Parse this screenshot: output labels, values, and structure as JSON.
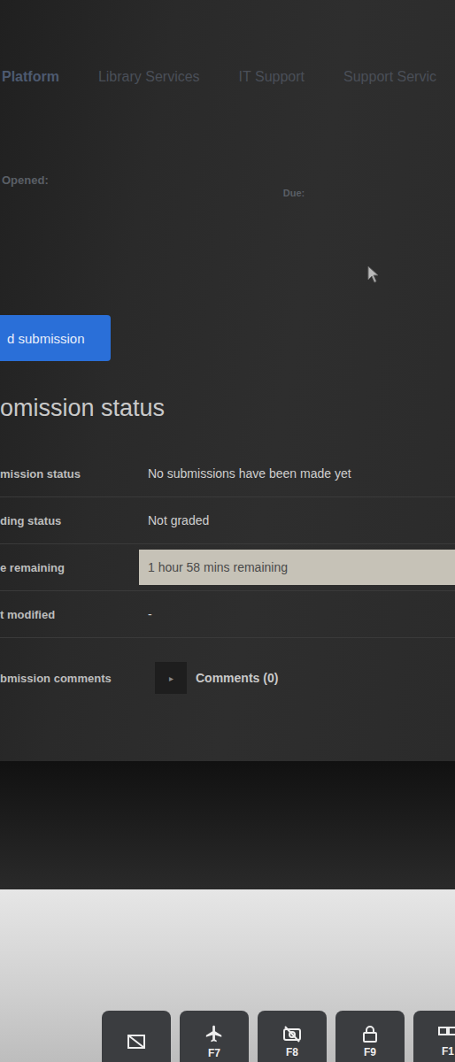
{
  "nav": [
    {
      "label": "Platform"
    },
    {
      "label": "Library Services"
    },
    {
      "label": "IT Support"
    },
    {
      "label": "Support Servic"
    }
  ],
  "dates": {
    "opened_label": "Opened:",
    "due_label": "Due:"
  },
  "submit_button": "d submission",
  "section_title": "omission status",
  "rows": [
    {
      "label": "mission status",
      "value": "No submissions have been made yet",
      "kind": "text",
      "highlighted": false,
      "icon": ""
    },
    {
      "label": "ding status",
      "value": "Not graded",
      "kind": "text",
      "highlighted": false,
      "icon": ""
    },
    {
      "label": "e remaining",
      "value": "1 hour 58 mins remaining",
      "kind": "text",
      "highlighted": true,
      "icon": ""
    },
    {
      "label": "t modified",
      "value": "-",
      "kind": "text",
      "highlighted": false,
      "icon": ""
    },
    {
      "label": "bmission comments",
      "value": "Comments (0)",
      "kind": "toggle",
      "highlighted": false,
      "icon": "▸"
    }
  ],
  "keys": [
    {
      "label": "F7",
      "icon": "airplane"
    },
    {
      "label": "F8",
      "icon": "camera-off"
    },
    {
      "label": "F9",
      "icon": "lock"
    },
    {
      "label": "F1",
      "icon": "monitor"
    }
  ]
}
